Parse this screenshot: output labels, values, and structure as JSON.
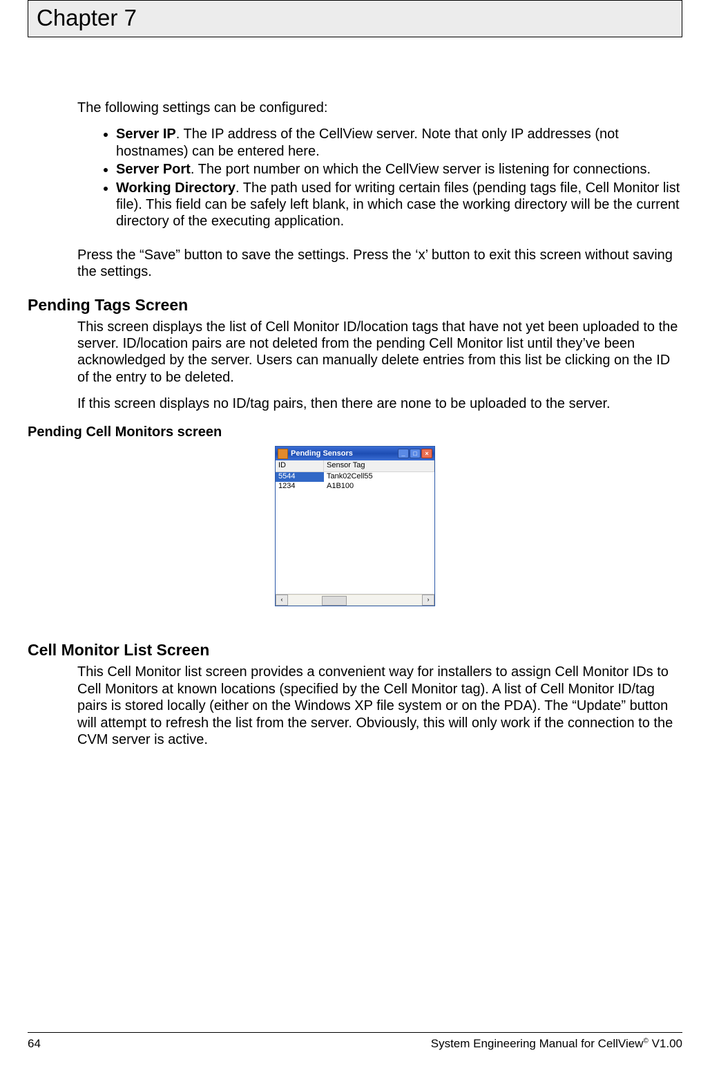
{
  "header": {
    "chapter": "Chapter 7"
  },
  "intro": "The following settings can be configured:",
  "bullets": [
    {
      "label": "Server IP",
      "text": ".  The IP address of the CellView server.  Note that only IP addresses (not hostnames) can be entered here."
    },
    {
      "label": "Server Port",
      "text": ". The port number on which the CellView server is listening for connections."
    },
    {
      "label": "Working Directory",
      "text": ". The path used for writing certain files (pending tags file, Cell Monitor list file).  This field can be safely left blank, in which case the working directory will be the current directory of the executing application."
    }
  ],
  "save_para": "Press the “Save” button to save the settings.  Press the ‘x’ button to exit this screen without saving the settings.",
  "pending": {
    "heading": "Pending Tags Screen",
    "p1": "This screen displays the list of Cell Monitor ID/location tags that have not yet been uploaded to the server.  ID/location pairs are not deleted from the pending Cell Monitor list until they’ve been acknowledged by the server.  Users can manually delete entries from this list be clicking on the ID of the entry to be deleted.",
    "p2": "If this screen displays no ID/tag pairs, then there are none to be uploaded to the server.",
    "subheading": "Pending Cell Monitors screen"
  },
  "mock": {
    "title": "Pending Sensors",
    "col_id": "ID",
    "col_tag": "Sensor Tag",
    "rows": [
      {
        "id": "5544",
        "tag": "Tank02Cell55",
        "selected": true
      },
      {
        "id": "1234",
        "tag": "A1B100",
        "selected": false
      }
    ]
  },
  "cellmon": {
    "heading": "Cell Monitor List Screen",
    "p1": "This Cell Monitor list screen provides a convenient way for installers to assign Cell Monitor IDs to Cell Monitors at known locations (specified by the Cell Monitor tag).  A list of Cell Monitor ID/tag pairs is stored locally (either on the Windows XP file system or on the PDA).  The “Update” button will attempt to refresh the list from the server.  Obviously, this will only work if the connection to the CVM server is active."
  },
  "footer": {
    "page": "64",
    "right_a": "System Engineering Manual for CellView",
    "right_sup": "©",
    "right_b": " V1.00"
  }
}
